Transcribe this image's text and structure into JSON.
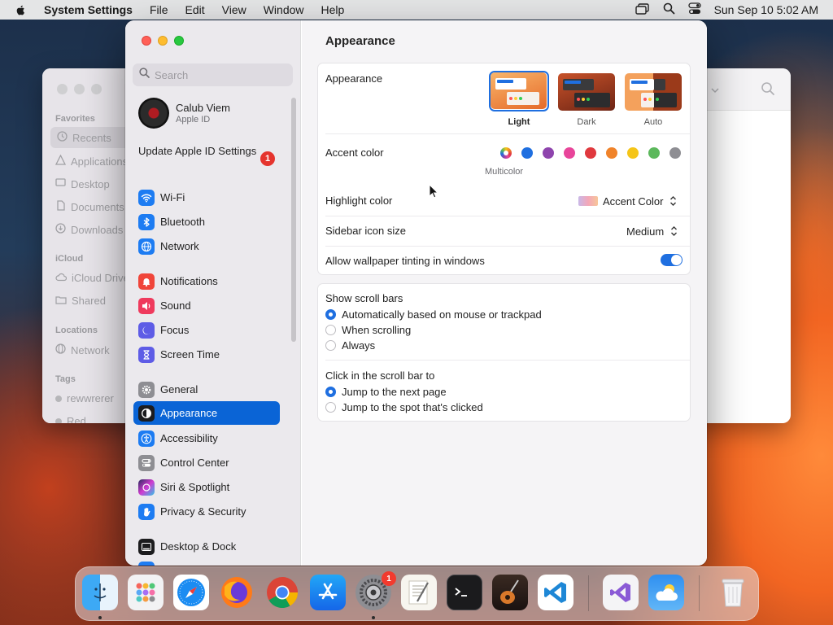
{
  "menubar": {
    "app_name": "System Settings",
    "menus": [
      "File",
      "Edit",
      "View",
      "Window",
      "Help"
    ],
    "datetime": "Sun Sep 10  5:02 AM"
  },
  "finder": {
    "sections": {
      "favorites": "Favorites",
      "icloud": "iCloud",
      "locations": "Locations",
      "tags": "Tags"
    },
    "items": [
      "Recents",
      "Applications",
      "Desktop",
      "Documents",
      "Downloads",
      "iCloud Drive",
      "Shared",
      "Network",
      "rewwrerer",
      "Red"
    ]
  },
  "sidebar": {
    "search_placeholder": "Search",
    "account_name": "Calub Viem",
    "account_sub": "Apple ID",
    "update_label": "Update Apple ID Settings",
    "update_badge": "1",
    "items": [
      {
        "label": "Wi-Fi"
      },
      {
        "label": "Bluetooth"
      },
      {
        "label": "Network"
      },
      {
        "label": "Notifications"
      },
      {
        "label": "Sound"
      },
      {
        "label": "Focus"
      },
      {
        "label": "Screen Time"
      },
      {
        "label": "General"
      },
      {
        "label": "Appearance"
      },
      {
        "label": "Accessibility"
      },
      {
        "label": "Control Center"
      },
      {
        "label": "Siri & Spotlight"
      },
      {
        "label": "Privacy & Security"
      },
      {
        "label": "Desktop & Dock"
      }
    ]
  },
  "main": {
    "title": "Appearance",
    "appearance_label": "Appearance",
    "appearance_options": {
      "light": "Light",
      "dark": "Dark",
      "auto": "Auto"
    },
    "selected_appearance": "Light",
    "accent_label": "Accent color",
    "accent_colors": [
      "#1f6fe0",
      "#8e44ad",
      "#e8459a",
      "#e0393e",
      "#f0832a",
      "#f5c518",
      "#5cb85c",
      "#8e8e93"
    ],
    "multicolor_label": "Multicolor",
    "highlight_label": "Highlight color",
    "highlight_value": "Accent Color",
    "icon_size_label": "Sidebar icon size",
    "icon_size_value": "Medium",
    "tinting_label": "Allow wallpaper tinting in windows",
    "tinting_on": true,
    "scrollbars_label": "Show scroll bars",
    "scrollbars_options": [
      "Automatically based on mouse or trackpad",
      "When scrolling",
      "Always"
    ],
    "click_label": "Click in the scroll bar to",
    "click_options": [
      "Jump to the next page",
      "Jump to the spot that's clicked"
    ],
    "help": "?"
  },
  "dock": {
    "settings_badge": "1"
  }
}
